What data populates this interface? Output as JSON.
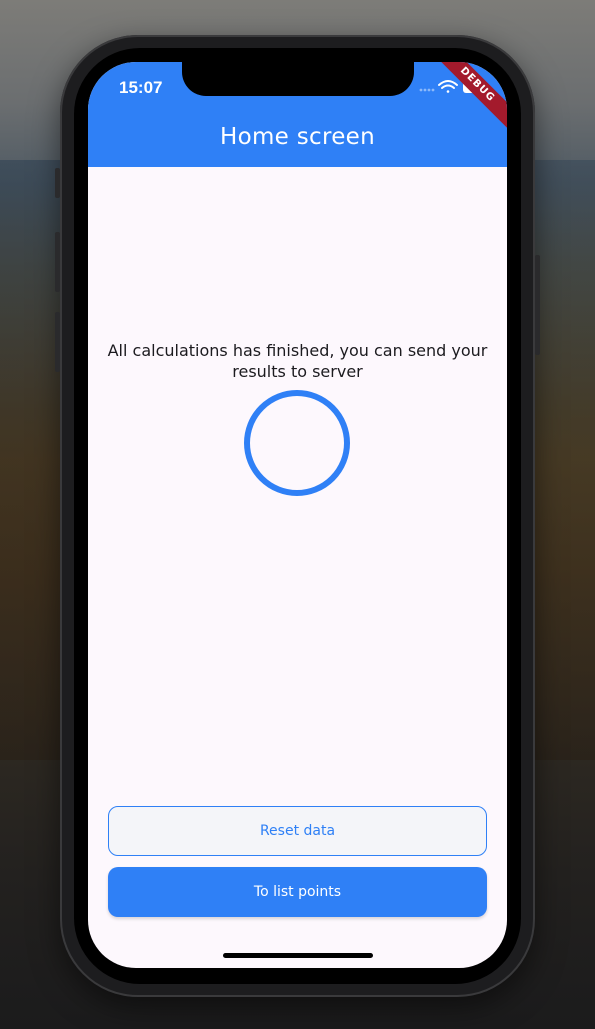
{
  "status_bar": {
    "time": "15:07",
    "icons": [
      "signal-dots-icon",
      "wifi-icon",
      "battery-icon"
    ]
  },
  "debug_banner": "DEBUG",
  "app_bar": {
    "title": "Home screen"
  },
  "main": {
    "message": "All calculations has finished, you can send your results to server",
    "spinner": "progress-ring"
  },
  "buttons": {
    "reset_label": "Reset data",
    "list_label": "To list points"
  },
  "colors": {
    "primary": "#2f80f6",
    "background": "#fdf8fd",
    "debug": "#a31a2c"
  }
}
